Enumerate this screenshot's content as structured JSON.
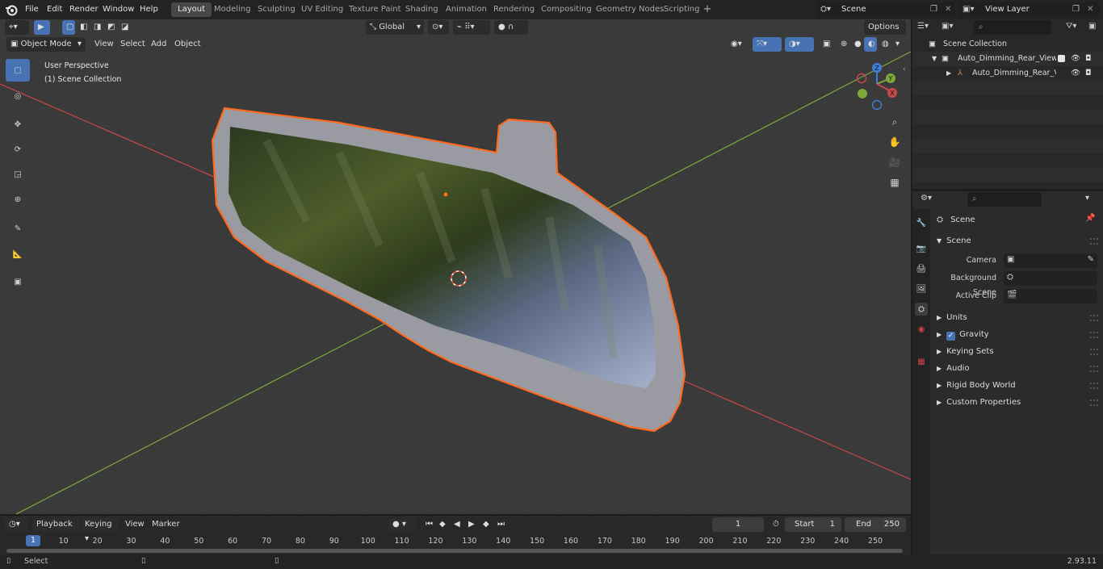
{
  "topbar": {
    "menus": [
      "File",
      "Edit",
      "Render",
      "Window",
      "Help"
    ],
    "workspaces": [
      "Layout",
      "Modeling",
      "Sculpting",
      "UV Editing",
      "Texture Paint",
      "Shading",
      "Animation",
      "Rendering",
      "Compositing",
      "Geometry Nodes",
      "Scripting"
    ],
    "active_workspace": "Layout",
    "scene_name": "Scene",
    "view_layer": "View Layer"
  },
  "viewport_header": {
    "mode": "Object Mode",
    "menus": [
      "View",
      "Select",
      "Add",
      "Object"
    ],
    "transform_orientation": "Global",
    "options_label": "Options"
  },
  "viewport": {
    "perspective_label": "User Perspective",
    "collection_label": "(1) Scene Collection",
    "gizmo_axes": {
      "x": "X",
      "y": "Y",
      "z": "Z"
    },
    "colors": {
      "selection_outline": "#ff6a1f",
      "x_axis": "#c74a4a",
      "y_axis": "#7fa83a",
      "z_axis": "#3f7fd9",
      "tool_active": "#4772b3"
    }
  },
  "toolbar": {
    "tools": [
      "select-box-icon",
      "cursor-icon",
      "move-icon",
      "rotate-icon",
      "scale-icon",
      "transform-icon",
      "annotate-icon",
      "measure-icon",
      "add-cube-icon"
    ],
    "active_tool": "select-box-icon"
  },
  "outliner": {
    "root": "Scene Collection",
    "items": [
      {
        "label": "Auto_Dimming_Rear_View_M",
        "level": 1
      },
      {
        "label": "Auto_Dimming_Rear_Vie",
        "level": 2
      }
    ]
  },
  "properties": {
    "context": "Scene",
    "panel_title": "Scene",
    "fields": [
      {
        "label": "Camera"
      },
      {
        "label": "Background Scene"
      },
      {
        "label": "Active Clip"
      }
    ],
    "sections": [
      "Units",
      "Gravity",
      "Keying Sets",
      "Audio",
      "Rigid Body World",
      "Custom Properties"
    ],
    "gravity_checked": true
  },
  "timeline": {
    "menus": [
      "Playback",
      "Keying",
      "View",
      "Marker"
    ],
    "current_frame": "1",
    "start_label": "Start",
    "start_value": "1",
    "end_label": "End",
    "end_value": "250",
    "ruler": [
      "1",
      "10",
      "20",
      "30",
      "40",
      "50",
      "60",
      "70",
      "80",
      "90",
      "100",
      "110",
      "120",
      "130",
      "140",
      "150",
      "160",
      "170",
      "180",
      "190",
      "200",
      "210",
      "220",
      "230",
      "240",
      "250"
    ]
  },
  "statusbar": {
    "left_label": "Select",
    "version": "2.93.11"
  }
}
